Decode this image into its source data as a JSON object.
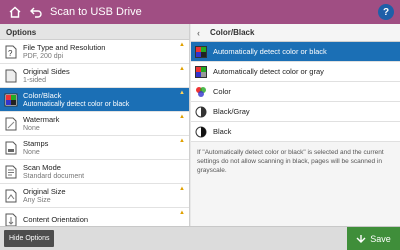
{
  "app": {
    "title": "Scan to USB Drive",
    "help_label": "?"
  },
  "colors": {
    "titlebar": "#a04e83",
    "selected": "#1b6fb5",
    "save": "#3f8e3a",
    "help": "#1f5fa8"
  },
  "left_panel": {
    "header": "Options",
    "items": [
      {
        "label": "File Type and Resolution",
        "value": "PDF, 200 dpi",
        "icon": "file-type-icon",
        "star": "▲"
      },
      {
        "label": "Original Sides",
        "value": "1-sided",
        "icon": "original-sides-icon",
        "star": "▲"
      },
      {
        "label": "Color/Black",
        "value": "Automatically detect color or black",
        "icon": "color-black-icon",
        "star": "▲"
      },
      {
        "label": "Watermark",
        "value": "None",
        "icon": "watermark-icon",
        "star": "▲"
      },
      {
        "label": "Stamps",
        "value": "None",
        "icon": "stamps-icon",
        "star": "▲"
      },
      {
        "label": "Scan Mode",
        "value": "Standard document",
        "icon": "scan-mode-icon",
        "star": ""
      },
      {
        "label": "Original Size",
        "value": "Any Size",
        "icon": "original-size-icon",
        "star": "▲"
      },
      {
        "label": "Content Orientation",
        "value": "",
        "icon": "orientation-icon",
        "star": "▲"
      }
    ]
  },
  "right_panel": {
    "header": "Color/Black",
    "choices": [
      {
        "label": "Automatically detect color or black",
        "icon": "auto-color-black-icon"
      },
      {
        "label": "Automatically detect color or gray",
        "icon": "auto-color-gray-icon"
      },
      {
        "label": "Color",
        "icon": "color-icon"
      },
      {
        "label": "Black/Gray",
        "icon": "black-gray-icon"
      },
      {
        "label": "Black",
        "icon": "black-icon"
      }
    ],
    "note": "If \"Automatically detect color or black\" is selected and the current settings do not allow scanning in black, pages will be scanned in grayscale."
  },
  "bottom": {
    "hide_options": "Hide Options",
    "save": "Save"
  }
}
